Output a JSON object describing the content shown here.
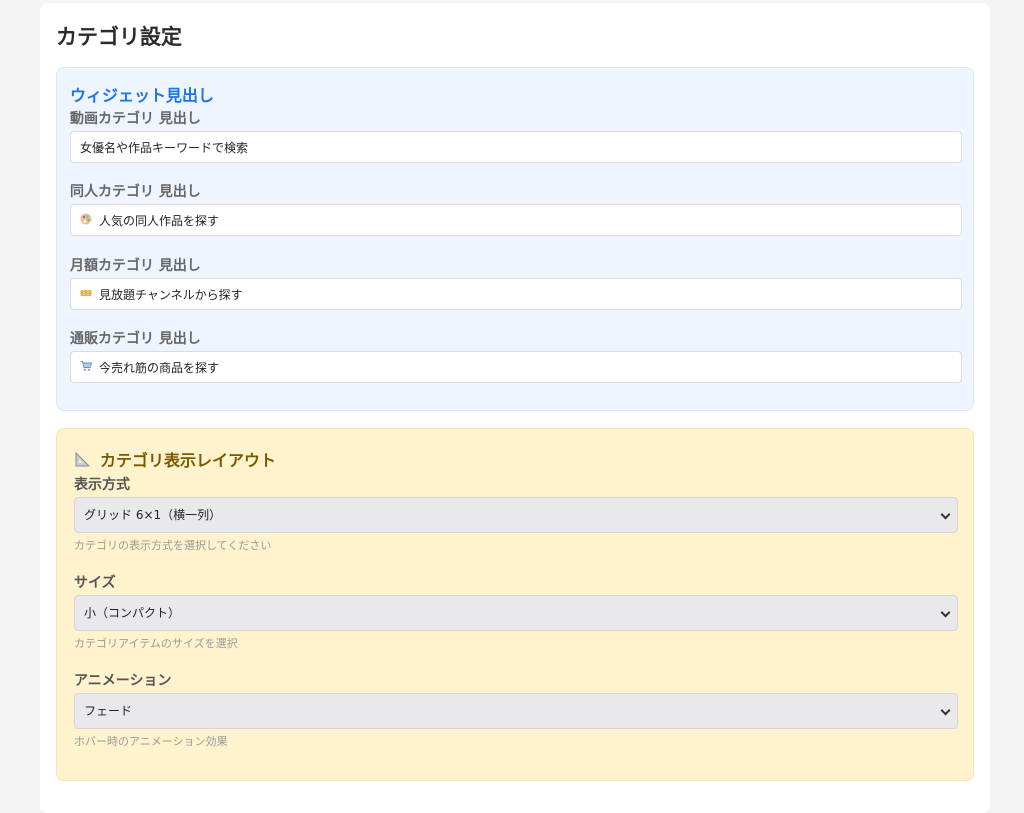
{
  "page": {
    "title": "カテゴリ設定"
  },
  "widget_headings": {
    "title": "ウィジェット見出し",
    "fields": [
      {
        "label": "動画カテゴリ 見出し",
        "value": "女優名や作品キーワードで検索",
        "icon": ""
      },
      {
        "label": "同人カテゴリ 見出し",
        "value": "人気の同人作品を探す",
        "icon": "palette-icon"
      },
      {
        "label": "月額カテゴリ 見出し",
        "value": "見放題チャンネルから探す",
        "icon": "ticket-icon"
      },
      {
        "label": "通販カテゴリ 見出し",
        "value": "今売れ筋の商品を探す",
        "icon": "cart-icon"
      }
    ]
  },
  "layout": {
    "title": "カテゴリ表示レイアウト",
    "icon": "triangle-ruler-icon",
    "display_mode": {
      "label": "表示方式",
      "selected": "グリッド 6×1（横一列）",
      "help": "カテゴリの表示方式を選択してください"
    },
    "size": {
      "label": "サイズ",
      "selected": "小（コンパクト）",
      "help": "カテゴリアイテムのサイズを選択"
    },
    "animation": {
      "label": "アニメーション",
      "selected": "フェード",
      "help": "ホバー時のアニメーション効果"
    }
  },
  "colors": {
    "accent_blue": "#1a73e8",
    "panel_blue": "#eef5fe",
    "panel_yellow": "#fff3cd",
    "yellow_title": "#7a5a00"
  }
}
